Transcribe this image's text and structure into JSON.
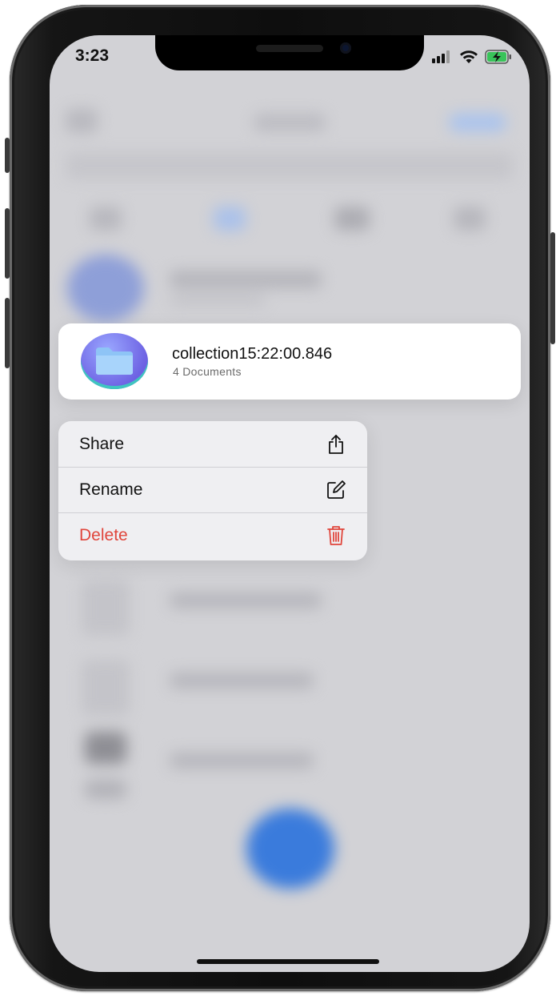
{
  "status_bar": {
    "time": "3:23"
  },
  "preview": {
    "title": "collection15:22:00.846",
    "subtitle": "4 Documents",
    "icon": "folder-icon"
  },
  "menu": {
    "items": [
      {
        "label": "Share",
        "icon": "share-icon"
      },
      {
        "label": "Rename",
        "icon": "edit-icon"
      },
      {
        "label": "Delete",
        "icon": "trash-icon",
        "destructive": true
      }
    ]
  },
  "colors": {
    "destructive": "#e0463c",
    "accent": "#3a7bdc",
    "avatar": "#6d62e3"
  }
}
